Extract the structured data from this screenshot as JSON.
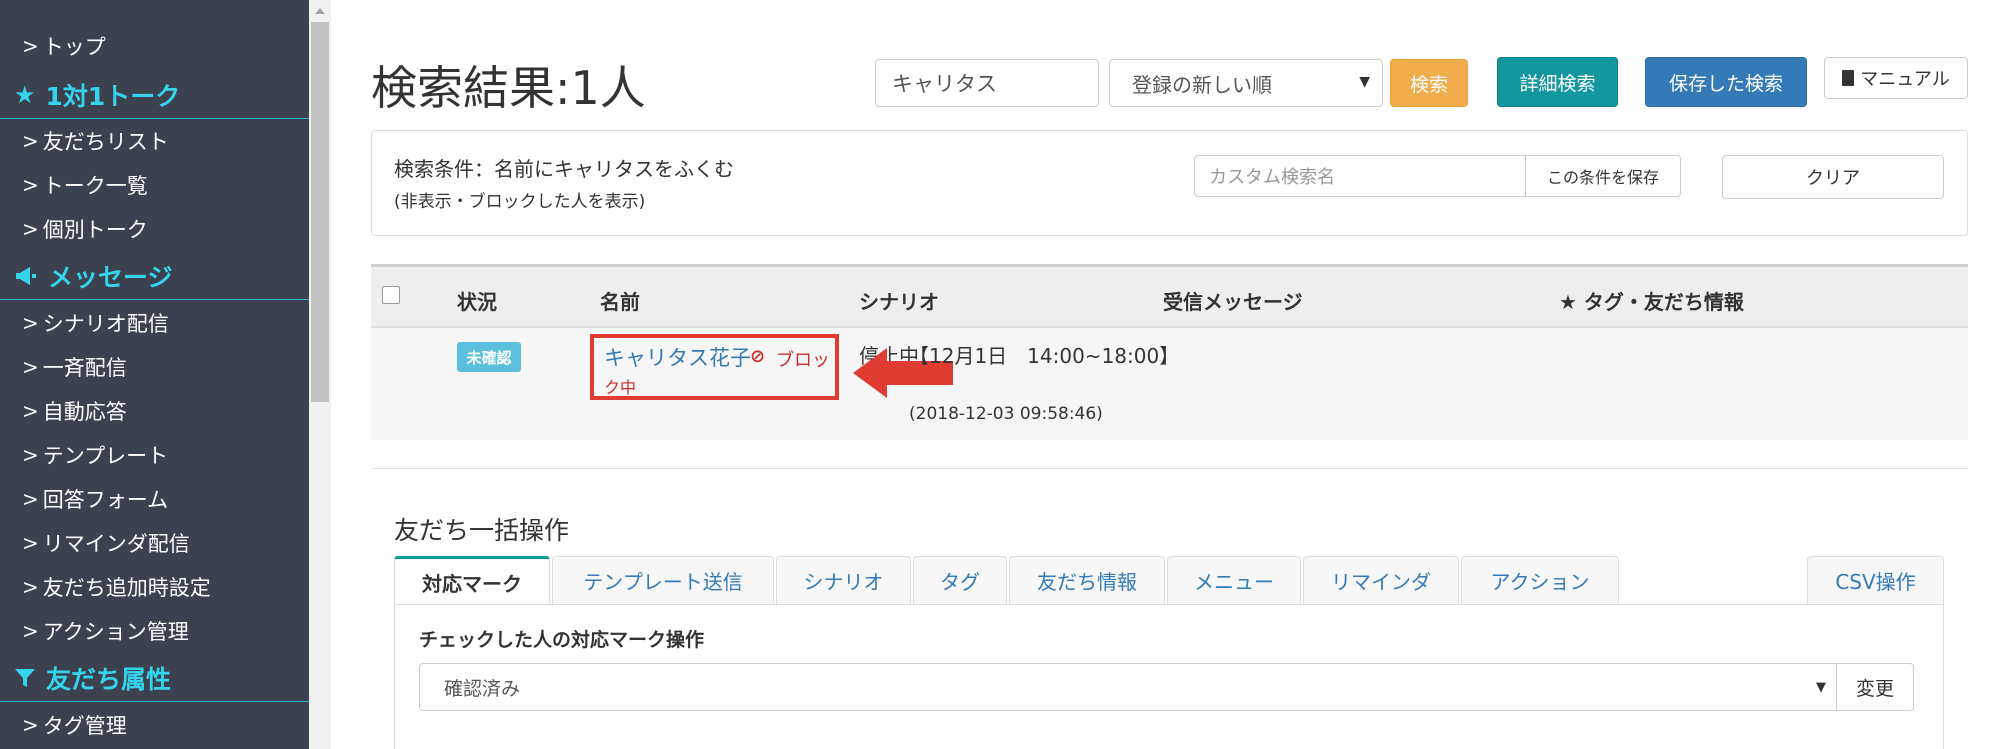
{
  "sidebar": {
    "items": [
      {
        "label": "トップ",
        "type": "item"
      },
      {
        "label": "1対1トーク",
        "type": "head",
        "icon": "star-icon"
      },
      {
        "label": "友だちリスト",
        "type": "item"
      },
      {
        "label": "トーク一覧",
        "type": "item"
      },
      {
        "label": "個別トーク",
        "type": "item"
      },
      {
        "label": "メッセージ",
        "type": "head",
        "icon": "megaphone-icon"
      },
      {
        "label": "シナリオ配信",
        "type": "item"
      },
      {
        "label": "一斉配信",
        "type": "item"
      },
      {
        "label": "自動応答",
        "type": "item"
      },
      {
        "label": "テンプレート",
        "type": "item"
      },
      {
        "label": "回答フォーム",
        "type": "item"
      },
      {
        "label": "リマインダ配信",
        "type": "item"
      },
      {
        "label": "友だち追加時設定",
        "type": "item"
      },
      {
        "label": "アクション管理",
        "type": "item"
      },
      {
        "label": "友だち属性",
        "type": "head",
        "icon": "filter-icon"
      },
      {
        "label": "タグ管理",
        "type": "item"
      }
    ],
    "chevron": ">",
    "head_color": "#33d4ec",
    "bg_color": "#3c4150"
  },
  "header": {
    "title": "検索結果:1人",
    "search_value": "キャリタス",
    "sort_selected": "登録の新しい順",
    "search_button": "検索",
    "advanced_button": "詳細検索",
    "saved_button": "保存した検索",
    "manual_button": "マニュアル"
  },
  "conditions": {
    "text": "検索条件：名前にキャリタスをふくむ",
    "sub": "(非表示・ブロックした人を表示)",
    "custom_name_placeholder": "カスタム検索名",
    "save_button": "この条件を保存",
    "clear_button": "クリア"
  },
  "table": {
    "columns": [
      "状況",
      "名前",
      "シナリオ",
      "受信メッセージ",
      "★ タグ・友だち情報"
    ],
    "rows": [
      {
        "status": "未確認",
        "name": "キャリタス花子",
        "block_label_1": "ブロッ",
        "block_label_2": "ク中",
        "block_icon": "⊘",
        "scenario": "停止中",
        "message": "【12月1日　14:00~18:00】",
        "message_time": "(2018-12-03 09:58:46)"
      }
    ]
  },
  "bulk": {
    "title": "友だち一括操作",
    "tabs": [
      "対応マーク",
      "テンプレート送信",
      "シナリオ",
      "タグ",
      "友だち情報",
      "メニュー",
      "リマインダ",
      "アクション",
      "CSV操作"
    ],
    "active_tab": "対応マーク",
    "panel_label": "チェックした人の対応マーク操作",
    "mark_selected": "確認済み",
    "change_button": "変更"
  },
  "colors": {
    "accent_teal": "#13979e",
    "primary_blue": "#337ab7",
    "warning_orange": "#f0ad4e",
    "highlight_red": "#e03c31"
  }
}
